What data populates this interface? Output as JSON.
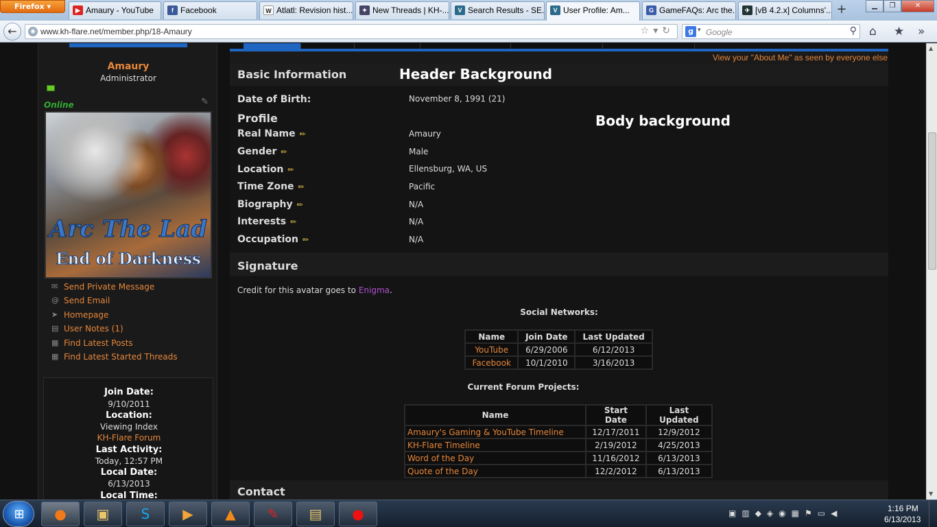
{
  "browser": {
    "app_button": "Firefox",
    "tabs": [
      {
        "label": "Amaury - YouTube",
        "icon": "youtube-icon",
        "color": "#d22"
      },
      {
        "label": "Facebook",
        "icon": "facebook-icon",
        "color": "#3b5998"
      },
      {
        "label": "Atlatl: Revision hist...",
        "icon": "wikipedia-icon",
        "color": "#444"
      },
      {
        "label": "New Threads | KH-...",
        "icon": "kh-icon",
        "color": "#446"
      },
      {
        "label": "Search Results - SE...",
        "icon": "vb-icon",
        "color": "#2b6a8a"
      },
      {
        "label": "User Profile: Am...",
        "icon": "vb-icon",
        "color": "#2b6a8a"
      },
      {
        "label": "GameFAQs: Arc the...",
        "icon": "gamefaqs-icon",
        "color": "#3a5aaa"
      },
      {
        "label": "[vB 4.2.x] Columns'...",
        "icon": "bird-icon",
        "color": "#233"
      }
    ],
    "new_tab": "+",
    "url": "www.kh-flare.net/member.php/18-Amaury",
    "search_placeholder": "Google"
  },
  "sidebar": {
    "username": "Amaury",
    "role": "Administrator",
    "status": "Online",
    "avatar_title_line1": "Arc The Lad",
    "avatar_title_line2": "End of Darkness",
    "links": [
      {
        "label": "Send Private Message",
        "icon": "envelope-icon"
      },
      {
        "label": "Send Email",
        "icon": "at-icon"
      },
      {
        "label": "Homepage",
        "icon": "cursor-icon"
      },
      {
        "label": "User Notes (1)",
        "icon": "note-icon"
      },
      {
        "label": "Find Latest Posts",
        "icon": "posts-icon"
      },
      {
        "label": "Find Latest Started Threads",
        "icon": "threads-icon"
      }
    ],
    "stats": {
      "join_date_label": "Join Date:",
      "join_date": "9/10/2011",
      "location_label": "Location:",
      "location_line1": "Viewing Index",
      "location_line2": "KH-Flare Forum",
      "last_activity_label": "Last Activity:",
      "last_activity": "Today, 12:57 PM",
      "local_date_label": "Local Date:",
      "local_date": "6/13/2013",
      "local_time_label": "Local Time:"
    }
  },
  "main": {
    "about_link": "View your \"About Me\" as seen by everyone else",
    "basic_info_title": "Basic Information",
    "header_background_label": "Header Background",
    "dob_label": "Date of Birth:",
    "dob_value": "November 8, 1991 (21)",
    "profile_title": "Profile",
    "body_background_label": "Body background",
    "profile_fields": [
      {
        "label": "Real Name",
        "value": "Amaury"
      },
      {
        "label": "Gender",
        "value": "Male"
      },
      {
        "label": "Location",
        "value": "Ellensburg, WA, US"
      },
      {
        "label": "Time Zone",
        "value": "Pacific"
      },
      {
        "label": "Biography",
        "value": "N/A"
      },
      {
        "label": "Interests",
        "value": "N/A"
      },
      {
        "label": "Occupation",
        "value": "N/A"
      }
    ],
    "signature_title": "Signature",
    "credit_prefix": "Credit for this avatar goes to ",
    "credit_link": "Enigma",
    "credit_suffix": ".",
    "social_title": "Social Networks:",
    "social_headers": [
      "Name",
      "Join Date",
      "Last Updated"
    ],
    "social_rows": [
      [
        "YouTube",
        "6/29/2006",
        "6/12/2013"
      ],
      [
        "Facebook",
        "10/1/2010",
        "3/16/2013"
      ]
    ],
    "projects_title": "Current Forum Projects:",
    "projects_headers": [
      "Name",
      "Start Date",
      "Last Updated"
    ],
    "projects_rows": [
      [
        "Amaury's Gaming & YouTube Timeline",
        "12/17/2011",
        "12/9/2012"
      ],
      [
        "KH-Flare Timeline",
        "2/19/2012",
        "4/25/2013"
      ],
      [
        "Word of the Day",
        "11/16/2012",
        "6/13/2013"
      ],
      [
        "Quote of the Day",
        "12/2/2012",
        "6/13/2013"
      ]
    ],
    "contact_title": "Contact"
  },
  "taskbar": {
    "clock_time": "1:16 PM",
    "clock_date": "6/13/2013"
  }
}
